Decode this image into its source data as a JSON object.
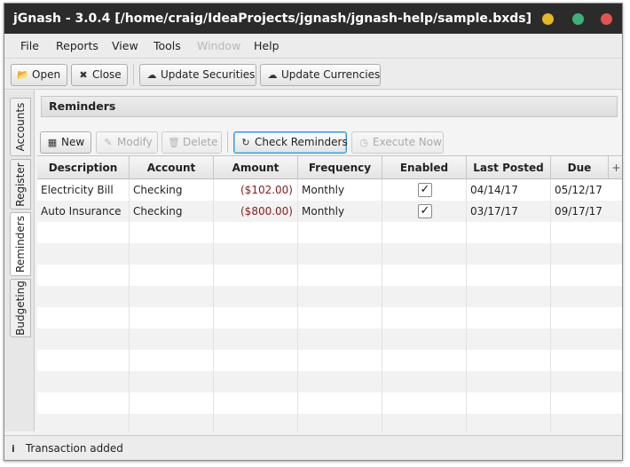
{
  "window": {
    "title": "jGnash - 3.0.4  [/home/craig/IdeaProjects/jgnash/jgnash-help/sample.bxds]",
    "controls": {
      "minimize_color": "#e5b62a",
      "maximize_color": "#3db07a",
      "close_color": "#e05454"
    }
  },
  "menubar": {
    "items": [
      "File",
      "Reports",
      "View",
      "Tools",
      "Window",
      "Help"
    ],
    "disabled_item": "Window"
  },
  "toolbar": {
    "open_label": "Open",
    "open_icon": "folder-open-icon",
    "close_label": "Close",
    "close_icon": "close-icon",
    "update_securities_label": "Update Securities",
    "update_securities_icon": "cloud-download-icon",
    "update_currencies_label": "Update Currencies",
    "update_currencies_icon": "cloud-download-icon"
  },
  "sidebar": {
    "tabs": [
      "Accounts",
      "Register",
      "Reminders",
      "Budgeting"
    ],
    "active_tab": "Reminders"
  },
  "reminders": {
    "header": "Reminders",
    "actions": {
      "new_label": "New",
      "new_icon": "calendar-icon",
      "modify_label": "Modify",
      "modify_icon": "edit-icon",
      "delete_label": "Delete",
      "delete_icon": "trash-icon",
      "check_label": "Check Reminders",
      "check_icon": "refresh-icon",
      "execute_label": "Execute Now",
      "execute_icon": "clock-icon"
    },
    "columns": [
      "Description",
      "Account",
      "Amount",
      "Frequency",
      "Enabled",
      "Last Posted",
      "Due"
    ],
    "column_menu_glyph": "+",
    "rows": [
      {
        "description": "Electricity Bill",
        "account": "Checking",
        "amount": "($102.00)",
        "frequency": "Monthly",
        "enabled": true,
        "last_posted": "04/14/17",
        "due": "05/12/17"
      },
      {
        "description": "Auto Insurance",
        "account": "Checking",
        "amount": "($800.00)",
        "frequency": "Monthly",
        "enabled": true,
        "last_posted": "03/17/17",
        "due": "09/17/17"
      }
    ],
    "amount_color": "#8b1a1a"
  },
  "status": {
    "icon": "info-icon",
    "text": "Transaction added"
  }
}
